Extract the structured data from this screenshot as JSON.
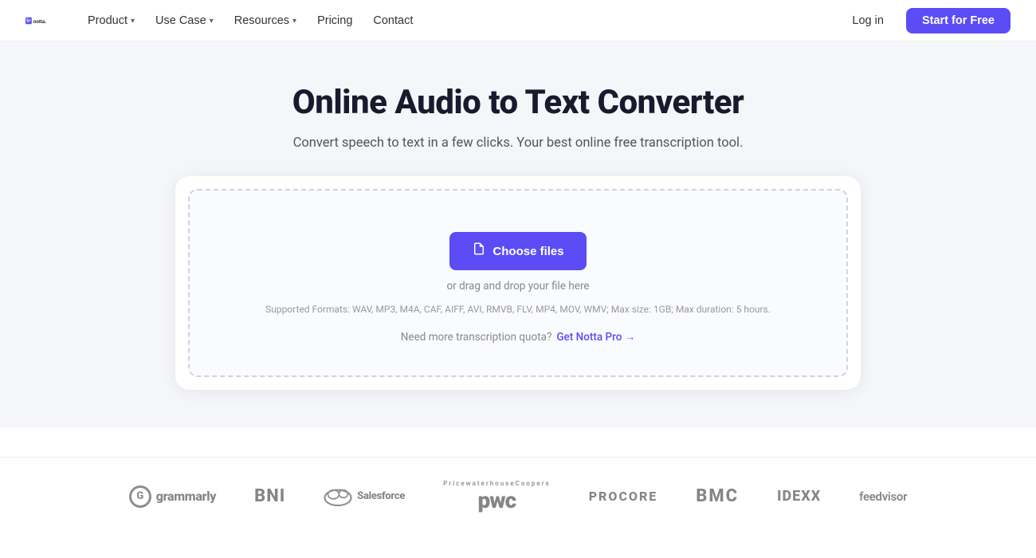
{
  "brand": {
    "name": "notta.",
    "logo_alt": "Notta logo"
  },
  "nav": {
    "links": [
      {
        "id": "product",
        "label": "Product",
        "has_dropdown": true
      },
      {
        "id": "use-case",
        "label": "Use Case",
        "has_dropdown": true
      },
      {
        "id": "resources",
        "label": "Resources",
        "has_dropdown": true
      },
      {
        "id": "pricing",
        "label": "Pricing",
        "has_dropdown": false
      },
      {
        "id": "contact",
        "label": "Contact",
        "has_dropdown": false
      }
    ],
    "login_label": "Log in",
    "start_label": "Start for Free"
  },
  "hero": {
    "title": "Online Audio to Text Converter",
    "subtitle": "Convert speech to text in a few clicks. Your best online free transcription tool."
  },
  "upload": {
    "choose_files_label": "Choose files",
    "or_text": "or drag and drop your file here",
    "formats_label": "Supported Formats: WAV, MP3, M4A, CAF, AIFF, AVI, RMVB, FLV, MP4, MOV, WMV; Max size: 1GB; Max duration: 5 hours.",
    "quota_text": "Need more transcription quota?",
    "pro_link_text": "Get Notta Pro →"
  },
  "logos": [
    {
      "id": "grammarly",
      "label": "grammarly",
      "has_g_icon": true
    },
    {
      "id": "bni",
      "label": "BNI",
      "style": "bold"
    },
    {
      "id": "salesforce",
      "label": "Salesforce",
      "has_cloud": true
    },
    {
      "id": "pwc",
      "label": "pwc",
      "style": "pwc"
    },
    {
      "id": "procore",
      "label": "PROCORE",
      "style": "bold"
    },
    {
      "id": "bmc",
      "label": "BMC",
      "style": "bold"
    },
    {
      "id": "idexx",
      "label": "IDEXX",
      "style": "bold"
    },
    {
      "id": "feedvisor",
      "label": "feedvisor",
      "style": "normal"
    }
  ],
  "colors": {
    "accent": "#5b4cf5",
    "nav_bg": "#ffffff",
    "hero_bg": "#f0f1f8"
  }
}
